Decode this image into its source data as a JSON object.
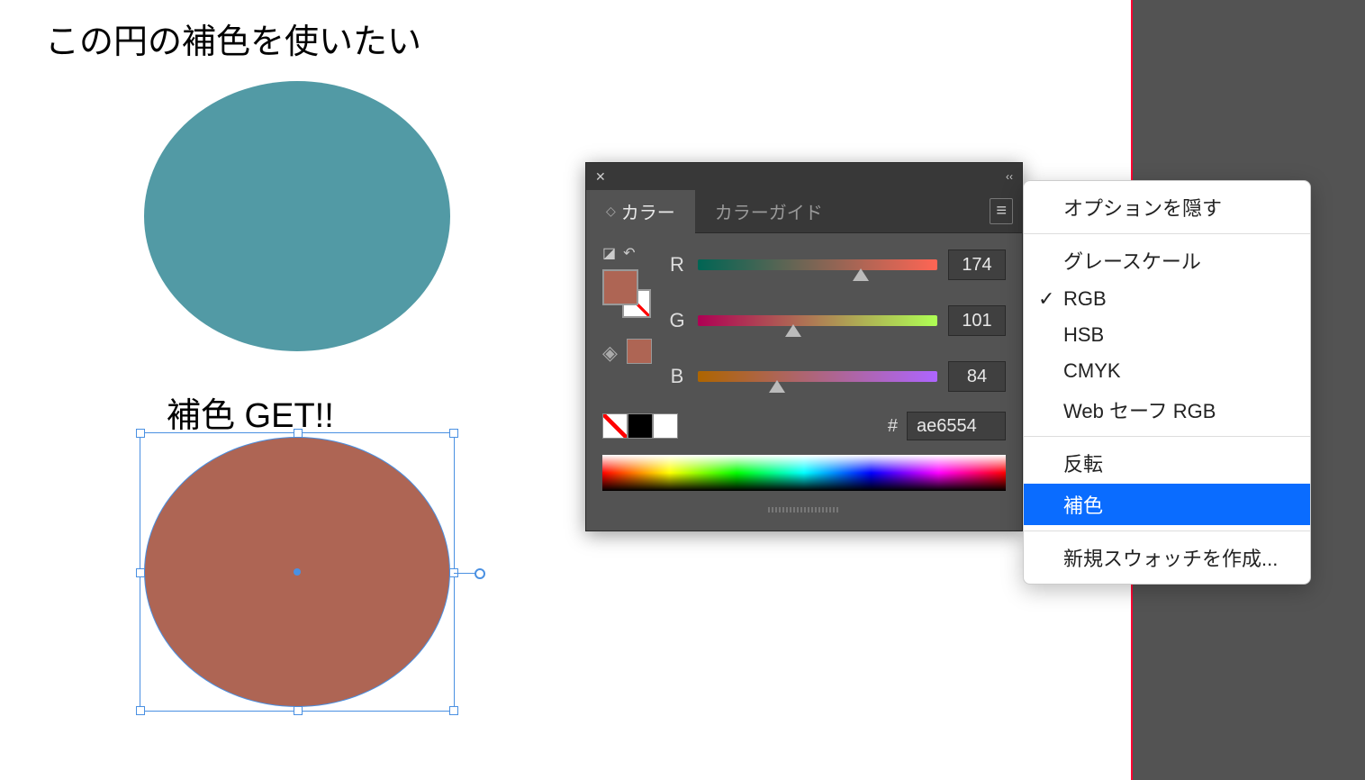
{
  "canvas": {
    "caption1": "この円の補色を使いたい",
    "caption2": "補色 GET!!",
    "teal_color": "#529aa5",
    "brown_color": "#ae6554"
  },
  "color_panel": {
    "tab_color": "カラー",
    "tab_guide": "カラーガイド",
    "r_label": "R",
    "g_label": "G",
    "b_label": "B",
    "r_value": "174",
    "g_value": "101",
    "b_value": "84",
    "hex_symbol": "#",
    "hex_value": "ae6554"
  },
  "menu": {
    "hide_options": "オプションを隠す",
    "grayscale": "グレースケール",
    "rgb": "RGB",
    "hsb": "HSB",
    "cmyk": "CMYK",
    "web_safe": "Web セーフ RGB",
    "invert": "反転",
    "complement": "補色",
    "new_swatch": "新規スウォッチを作成..."
  }
}
